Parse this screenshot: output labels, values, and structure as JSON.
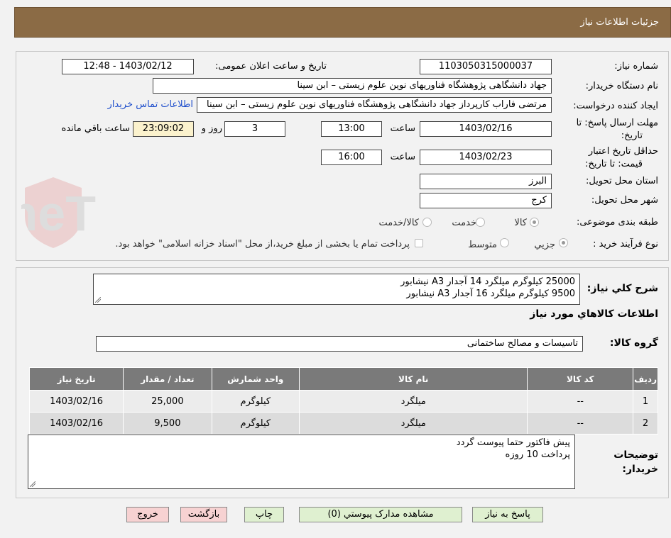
{
  "header": {
    "title": "جزئیات اطلاعات نیاز"
  },
  "form": {
    "need_number_label": "شماره نیاز:",
    "need_number": "1103050315000037",
    "announce_label": "تاریخ و ساعت اعلان عمومی:",
    "announce_value": "1403/02/12 - 12:48",
    "buyer_org_label": "نام دستگاه خریدار:",
    "buyer_org": "جهاد دانشگاهی پژوهشگاه فناوریهای نوین علوم زیستی – ابن سینا",
    "requester_label": "ایجاد کننده درخواست:",
    "requester": "مرتضی فاراب کارپرداز جهاد دانشگاهی پژوهشگاه فناوریهای نوین علوم زیستی – ابن سینا",
    "contact_link": "اطلاعات تماس خریدار",
    "deadline_label_1": "مهلت ارسال پاسخ: تا",
    "deadline_label_2": "تاریخ:",
    "deadline_date": "1403/02/16",
    "hour_label": "ساعت",
    "deadline_time": "13:00",
    "days_value": "3",
    "days_label": "روز و",
    "remaining_time": "23:09:02",
    "remaining_label": "ساعت باقي مانده",
    "validity_label_1": "حداقل تاریخ اعتبار",
    "validity_label_2": "قیمت: تا تاریخ:",
    "validity_date": "1403/02/23",
    "validity_time": "16:00",
    "province_label": "استان محل تحویل:",
    "province": "البرز",
    "city_label": "شهر محل تحویل:",
    "city": "کرج",
    "category_label": "طبقه بندی موضوعی:",
    "category_options": [
      "کالا",
      "خدمت",
      "کالا/خدمت"
    ],
    "process_label": "نوع فرآیند خرید :",
    "process_options": [
      "جزیي",
      "متوسط"
    ],
    "payment_note": "پرداخت تمام یا بخشی از مبلغ خرید،از محل \"اسناد خزانه اسلامی\" خواهد بود."
  },
  "details": {
    "summary_label": "شرح کلي نیاز:",
    "summary_lines": [
      "25000 کیلوگرم میلگرد 14 آجدار A3 نیشابور",
      "9500 کیلوگرم میلگرد 16 آجدار A3 نیشابور"
    ],
    "goods_info_title": "اطلاعات کالاهاي مورد نیاز",
    "group_label": "گروه کالا:",
    "group_value": "تاسیسات و مصالح ساختمانی"
  },
  "table": {
    "headers": [
      "ردیف",
      "کد کالا",
      "نام کالا",
      "واحد شمارش",
      "تعداد / مقدار",
      "تاریخ نیاز"
    ],
    "rows": [
      [
        "1",
        "--",
        "میلگرد",
        "کیلوگرم",
        "25,000",
        "1403/02/16"
      ],
      [
        "2",
        "--",
        "میلگرد",
        "کیلوگرم",
        "9,500",
        "1403/02/16"
      ]
    ]
  },
  "buyer_notes": {
    "label_1": "توضیحات",
    "label_2": "خریدار:",
    "lines": [
      "پیش فاکتور حتما پیوست گردد",
      "پرداخت 10 روزه"
    ]
  },
  "buttons": {
    "reply": "پاسخ به نیاز",
    "attachments": "مشاهده مدارک پیوستي (0)",
    "print": "چاپ",
    "back": "بازگشت",
    "exit": "خروج"
  },
  "watermark": {
    "text": "AriaTender.neT"
  },
  "colors": {
    "header": "#8b6b45",
    "table_header": "#7a7a7a",
    "highlight": "#fbf2cd",
    "link": "#1f4fcc"
  }
}
